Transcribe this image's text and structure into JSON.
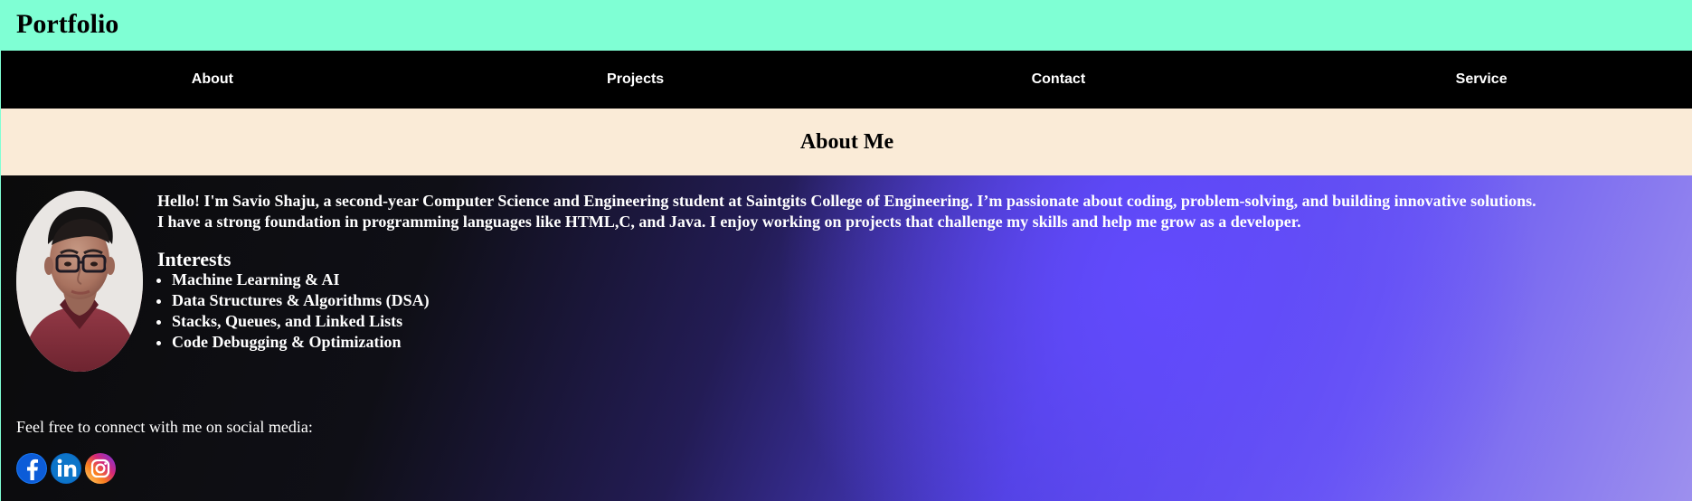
{
  "header": {
    "title": "Portfolio",
    "background_color": "#7fffd4"
  },
  "nav": {
    "background_color": "#000000",
    "items": [
      {
        "label": "About"
      },
      {
        "label": "Projects"
      },
      {
        "label": "Contact"
      },
      {
        "label": "Service"
      }
    ]
  },
  "about": {
    "section_title": "About Me",
    "intro_lines": [
      "Hello! I'm Savio Shaju, a second-year Computer Science and Engineering student at Saintgits College of Engineering. I’m passionate about coding, problem-solving, and building innovative solutions.",
      "I have a strong foundation in programming languages like HTML,C, and Java. I enjoy working on projects that challenge my skills and help me grow as a developer."
    ],
    "interests_title": "Interests",
    "interests": [
      "Machine Learning & AI",
      "Data Structures & Algorithms (DSA)",
      "Stacks, Queues, and Linked Lists",
      "Code Debugging & Optimization"
    ],
    "social_prompt": "Feel free to connect with me on social media:",
    "social_icons": [
      {
        "icon": "facebook-icon"
      },
      {
        "icon": "linkedin-icon"
      },
      {
        "icon": "instagram-icon"
      }
    ],
    "colors": {
      "section_header_background": "#faebd7",
      "panel_gradient_start": "#0b0b0b",
      "panel_gradient_mid": "#5f4df1",
      "panel_gradient_end": "#9d90ee",
      "facebook": "#1877f2",
      "linkedin": "#0a66c2",
      "instagram": "#d62976"
    }
  }
}
